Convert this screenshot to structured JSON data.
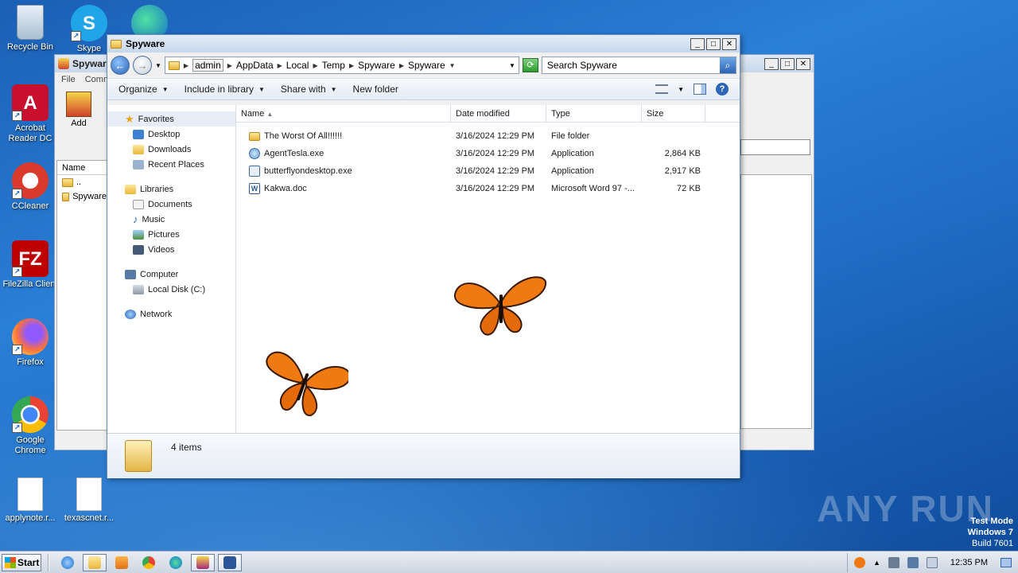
{
  "desktop": {
    "icons": [
      {
        "label": "Recycle Bin",
        "icon": "recycle-bin-icon"
      },
      {
        "label": "Skype",
        "icon": "skype-icon"
      },
      {
        "label": "Acrobat Reader DC",
        "icon": "acrobat-icon"
      },
      {
        "label": "CCleaner",
        "icon": "ccleaner-icon"
      },
      {
        "label": "FileZilla Client",
        "icon": "filezilla-icon"
      },
      {
        "label": "Firefox",
        "icon": "firefox-icon"
      },
      {
        "label": "Google Chrome",
        "icon": "chrome-icon"
      },
      {
        "label": "applynote.r...",
        "icon": "file-icon"
      },
      {
        "label": "texascnet.r...",
        "icon": "file-icon"
      }
    ],
    "watermark": "ANY RUN",
    "test_mode": {
      "line1": "Test Mode",
      "line2": "Windows 7",
      "line3": "Build 7601"
    }
  },
  "bg_window": {
    "title": "Spyware",
    "menu": [
      "File",
      "Comm"
    ],
    "add_label": "Add",
    "list_header": "Name",
    "rows": [
      "..",
      "Spyware"
    ]
  },
  "explorer": {
    "title": "Spyware",
    "breadcrumb": [
      "admin",
      "AppData",
      "Local",
      "Temp",
      "Spyware",
      "Spyware"
    ],
    "search_placeholder": "Search Spyware",
    "commands": [
      "Organize",
      "Include in library",
      "Share with",
      "New folder"
    ],
    "nav": {
      "favorites": "Favorites",
      "favorites_items": [
        "Desktop",
        "Downloads",
        "Recent Places"
      ],
      "libraries": "Libraries",
      "libraries_items": [
        "Documents",
        "Music",
        "Pictures",
        "Videos"
      ],
      "computer": "Computer",
      "computer_items": [
        "Local Disk (C:)"
      ],
      "network": "Network"
    },
    "columns": [
      "Name",
      "Date modified",
      "Type",
      "Size"
    ],
    "files": [
      {
        "name": "The Worst Of All!!!!!!",
        "date": "3/16/2024 12:29 PM",
        "type": "File folder",
        "size": "",
        "icon": "folder"
      },
      {
        "name": "AgentTesla.exe",
        "date": "3/16/2024 12:29 PM",
        "type": "Application",
        "size": "2,864 KB",
        "icon": "exe"
      },
      {
        "name": "butterflyondesktop.exe",
        "date": "3/16/2024 12:29 PM",
        "type": "Application",
        "size": "2,917 KB",
        "icon": "exe2"
      },
      {
        "name": "Kakwa.doc",
        "date": "3/16/2024 12:29 PM",
        "type": "Microsoft Word 97 -...",
        "size": "72 KB",
        "icon": "doc"
      }
    ],
    "status": "4 items"
  },
  "taskbar": {
    "start": "Start",
    "clock": "12:35 PM"
  },
  "colors": {
    "accent": "#2d65b8",
    "butterfly_orange": "#f07a12"
  }
}
